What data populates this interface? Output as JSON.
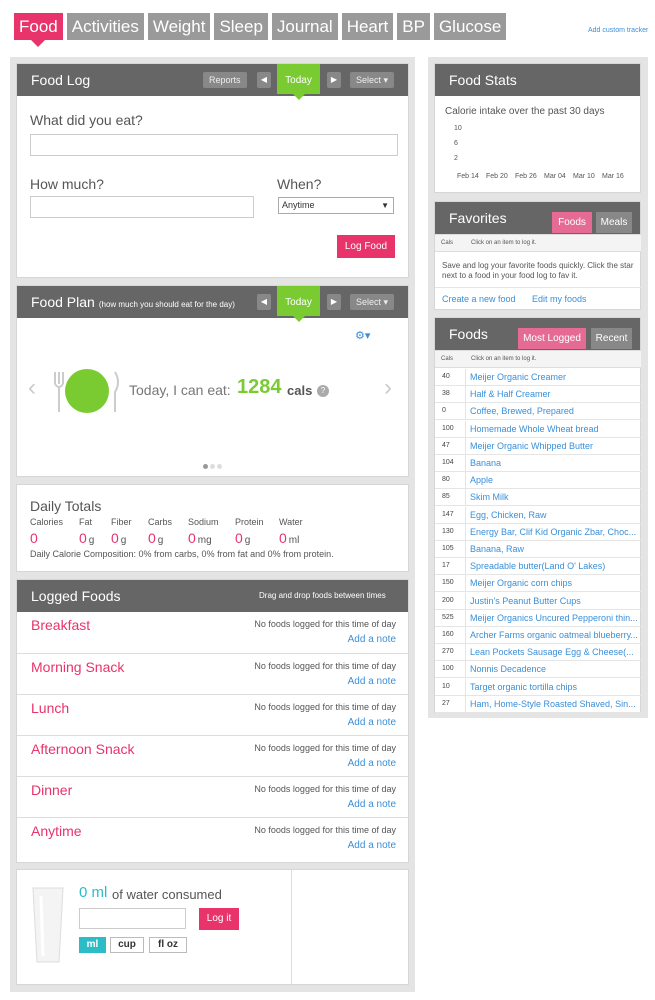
{
  "nav": {
    "tabs": [
      "Food",
      "Activities",
      "Weight",
      "Sleep",
      "Journal",
      "Heart",
      "BP",
      "Glucose"
    ],
    "add_tracker": "Add custom tracker"
  },
  "food_log": {
    "title": "Food Log",
    "reports": "Reports",
    "today": "Today",
    "select": "Select",
    "what_label": "What did you eat?",
    "how_much_label": "How much?",
    "when_label": "When?",
    "when_value": "Anytime",
    "log_button": "Log Food"
  },
  "food_plan": {
    "title": "Food Plan",
    "subtitle": "(how much you should eat for the day)",
    "today": "Today",
    "select": "Select",
    "can_eat_text": "Today, I can eat:",
    "cals_value": "1284",
    "cals_unit": "cals"
  },
  "daily_totals": {
    "title": "Daily Totals",
    "nutrients": [
      {
        "label": "Calories",
        "value": "0",
        "unit": ""
      },
      {
        "label": "Fat",
        "value": "0",
        "unit": "g"
      },
      {
        "label": "Fiber",
        "value": "0",
        "unit": "g"
      },
      {
        "label": "Carbs",
        "value": "0",
        "unit": "g"
      },
      {
        "label": "Sodium",
        "value": "0",
        "unit": "mg"
      },
      {
        "label": "Protein",
        "value": "0",
        "unit": "g"
      },
      {
        "label": "Water",
        "value": "0",
        "unit": "ml"
      }
    ],
    "composition": "Daily Calorie Composition: 0% from carbs, 0% from fat and 0% from protein."
  },
  "logged_foods": {
    "title": "Logged Foods",
    "hint": "Drag and drop foods between times",
    "none_text": "No foods logged for this time of day",
    "add_note": "Add a note",
    "meals": [
      "Breakfast",
      "Morning Snack",
      "Lunch",
      "Afternoon Snack",
      "Dinner",
      "Anytime"
    ]
  },
  "water": {
    "value": "0 ml",
    "label": "of water consumed",
    "log_button": "Log it",
    "units": [
      "ml",
      "cup",
      "fl oz"
    ]
  },
  "food_stats": {
    "title": "Food Stats",
    "subtitle": "Calorie intake over the past 30 days",
    "y_ticks": [
      "10",
      "6",
      "2"
    ],
    "x_ticks": [
      "Feb 14",
      "Feb 20",
      "Feb 26",
      "Mar 04",
      "Mar 10",
      "Mar 16"
    ]
  },
  "favorites": {
    "title": "Favorites",
    "tab_foods": "Foods",
    "tab_meals": "Meals",
    "col_cals": "Cals",
    "col_hint": "Click on an item to log it.",
    "text": "Save and log your favorite foods quickly. Click the star next to a food in your food log to fav it.",
    "create_link": "Create a new food",
    "edit_link": "Edit my foods"
  },
  "foods": {
    "title": "Foods",
    "tab_most": "Most Logged",
    "tab_recent": "Recent",
    "col_cals": "Cals",
    "col_hint": "Click on an item to log it.",
    "items": [
      {
        "cals": "40",
        "name": "Meijer Organic Creamer"
      },
      {
        "cals": "38",
        "name": "Half & Half Creamer"
      },
      {
        "cals": "0",
        "name": "Coffee, Brewed, Prepared"
      },
      {
        "cals": "100",
        "name": "Homemade Whole Wheat bread"
      },
      {
        "cals": "47",
        "name": "Meijer Organic Whipped Butter"
      },
      {
        "cals": "104",
        "name": "Banana"
      },
      {
        "cals": "80",
        "name": "Apple"
      },
      {
        "cals": "85",
        "name": "Skim Milk"
      },
      {
        "cals": "147",
        "name": "Egg, Chicken, Raw"
      },
      {
        "cals": "130",
        "name": "Energy Bar, Clif Kid Organic Zbar, Choc..."
      },
      {
        "cals": "105",
        "name": "Banana, Raw"
      },
      {
        "cals": "17",
        "name": "Spreadable butter(Land O' Lakes)"
      },
      {
        "cals": "150",
        "name": "Meijer Organic corn chips"
      },
      {
        "cals": "200",
        "name": "Justin's Peanut Butter Cups"
      },
      {
        "cals": "525",
        "name": "Meijer Organics Uncured Pepperoni thin..."
      },
      {
        "cals": "160",
        "name": "Archer Farms organic oatmeal blueberry..."
      },
      {
        "cals": "270",
        "name": "Lean Pockets Sausage Egg & Cheese(..."
      },
      {
        "cals": "100",
        "name": "Nonnis Decadence"
      },
      {
        "cals": "10",
        "name": "Target organic tortilla chips"
      },
      {
        "cals": "27",
        "name": "Ham, Home-Style Roasted Shaved, Sin..."
      }
    ]
  }
}
